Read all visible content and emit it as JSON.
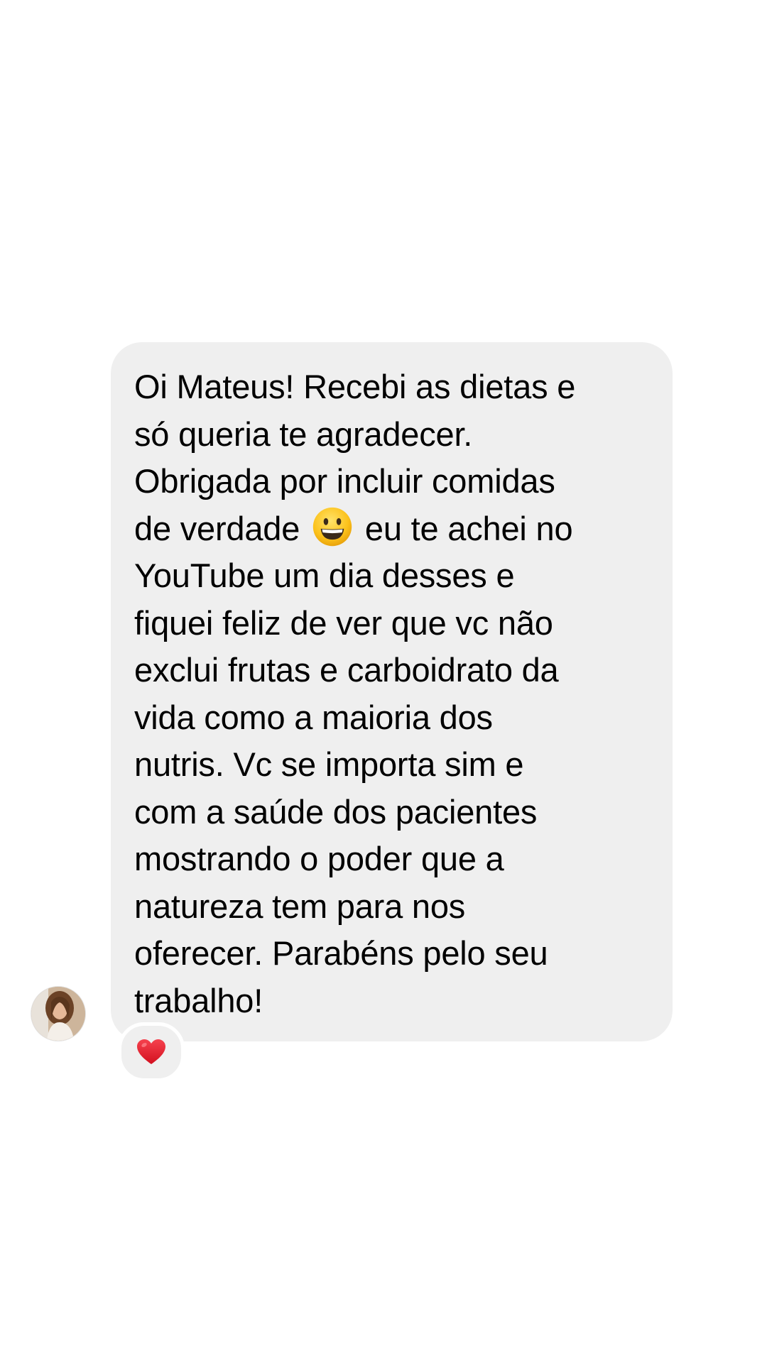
{
  "conversation": {
    "message": {
      "line_1": "Oi Mateus! Recebi as dietas e",
      "line_2": "só queria te agradecer.",
      "line_3": "Obrigada por incluir comidas",
      "line_4_before_emoji": "de verdade",
      "emoji": "grinning-face-emoji",
      "line_4_after_emoji": "eu te achei no",
      "line_5": "YouTube um dia desses e",
      "line_6": "fiquei feliz de ver que vc não",
      "line_7": "exclui frutas e carboidrato da",
      "line_8": "vida como a maioria dos",
      "line_9": "nutris. Vc se importa sim e",
      "line_10": "com a saúde dos pacientes",
      "line_11": "mostrando o poder que a",
      "line_12": "natureza tem para nos",
      "line_13": "oferecer. Parabéns pelo seu",
      "line_14": "trabalho!"
    },
    "reaction": "red-heart-icon",
    "sender_avatar": "sender-avatar-photo"
  },
  "colors": {
    "background": "#ffffff",
    "bubble": "#efefef",
    "text": "#000000",
    "heart": "#e0192d"
  }
}
